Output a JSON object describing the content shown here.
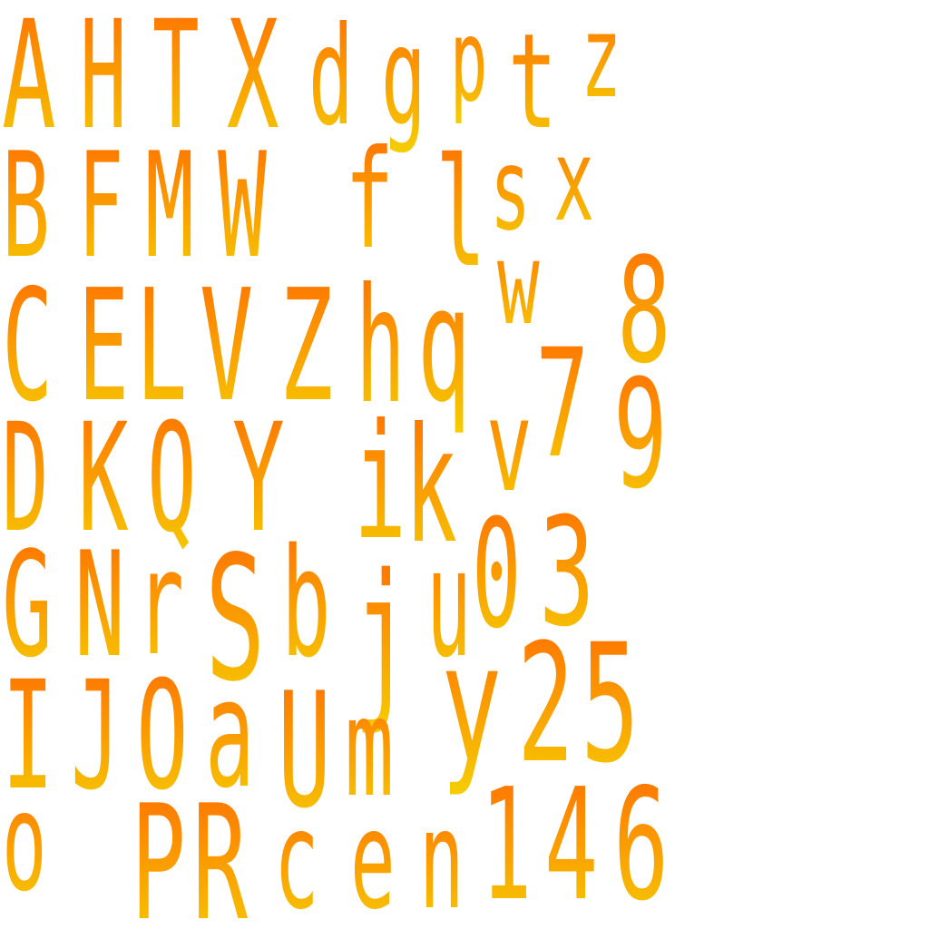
{
  "colors": {
    "gradient_top": "#ff6a00",
    "gradient_bottom": "#f5d000",
    "background": "#ffffff"
  },
  "glyphs": [
    "A",
    "H",
    "T",
    "X",
    "d",
    "g",
    "p",
    "t",
    "z",
    "B",
    "F",
    "M",
    "W",
    "f",
    "l",
    "s",
    "x",
    "C",
    "E",
    "L",
    "V",
    "Z",
    "h",
    "q",
    "w",
    "8",
    "7",
    "D",
    "K",
    "Q",
    "Y",
    "i",
    "k",
    "v",
    "9",
    "G",
    "N",
    "r",
    "S",
    "b",
    "j",
    "u",
    "0",
    "3",
    "y",
    "2",
    "5",
    "I",
    "J",
    "O",
    "a",
    "U",
    "m",
    "o",
    "P",
    "R",
    "c",
    "e",
    "n",
    "1",
    "4",
    "6"
  ]
}
